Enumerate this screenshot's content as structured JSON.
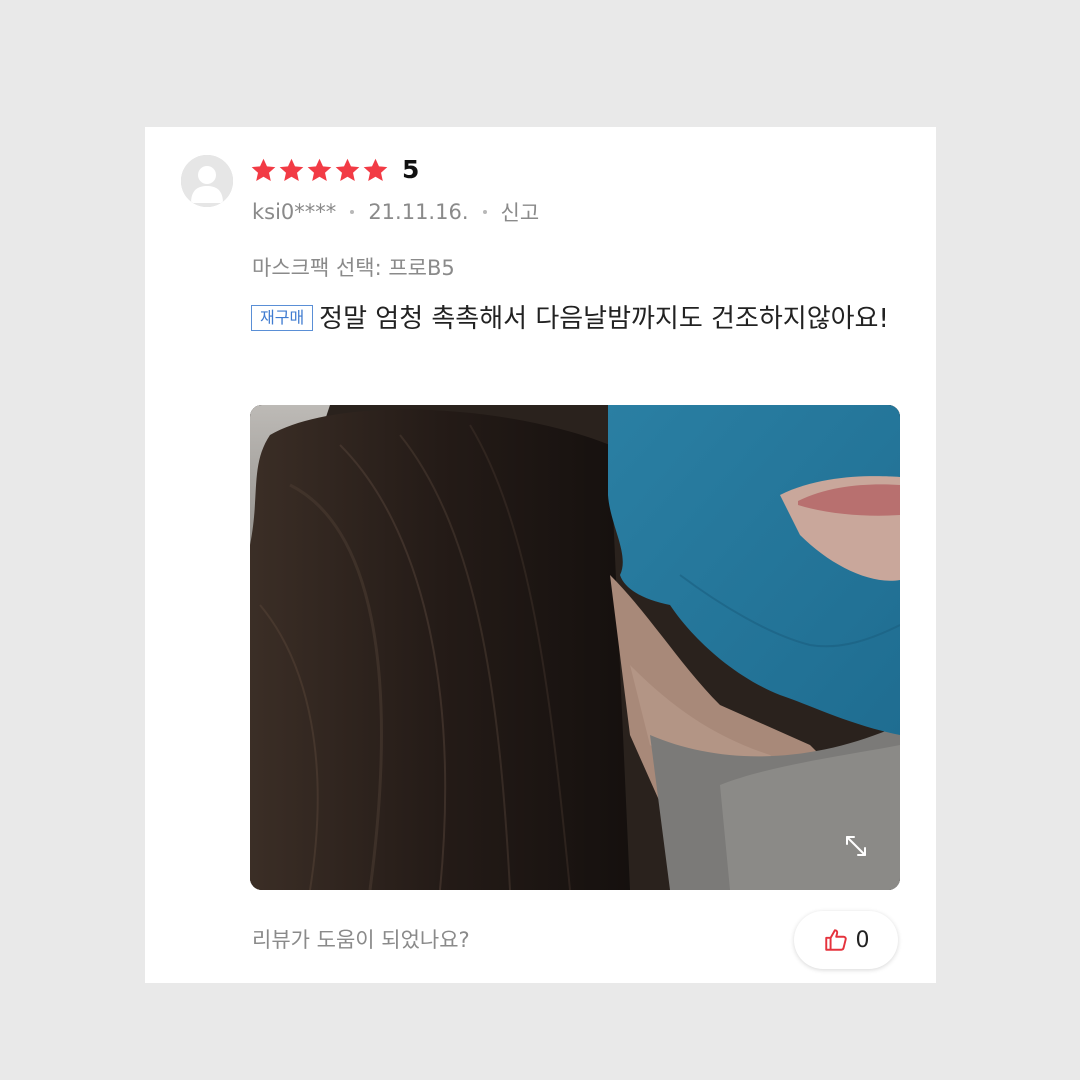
{
  "review": {
    "rating": "5",
    "rating_value": 5,
    "rating_max": 5,
    "username": "ksi0****",
    "date": "21.11.16.",
    "report_label": "신고",
    "option_text": "마스크팩 선택: 프로B5",
    "repurchase_badge": "재구매",
    "body": "정말 엄청 촉촉해서 다음날밤까지도 건조하지않아요!",
    "helpful_prompt": "리뷰가 도움이 되었나요?",
    "like_count": "0"
  },
  "colors": {
    "star": "#f23b45",
    "badge": "#3f7bd0",
    "like_icon": "#e5333d"
  },
  "icons": {
    "avatar": "default-user-avatar-icon",
    "star": "star-icon",
    "expand": "expand-icon",
    "like": "thumbs-up-icon"
  }
}
